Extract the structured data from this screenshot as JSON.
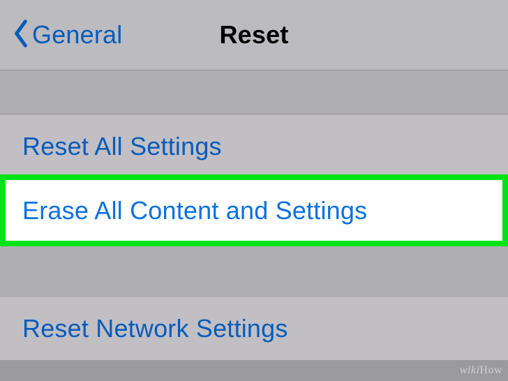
{
  "nav": {
    "back_label": "General",
    "title": "Reset"
  },
  "cells": {
    "reset_all": "Reset All Settings",
    "erase_all": "Erase All Content and Settings",
    "reset_network": "Reset Network Settings"
  },
  "watermark": "wikiHow"
}
